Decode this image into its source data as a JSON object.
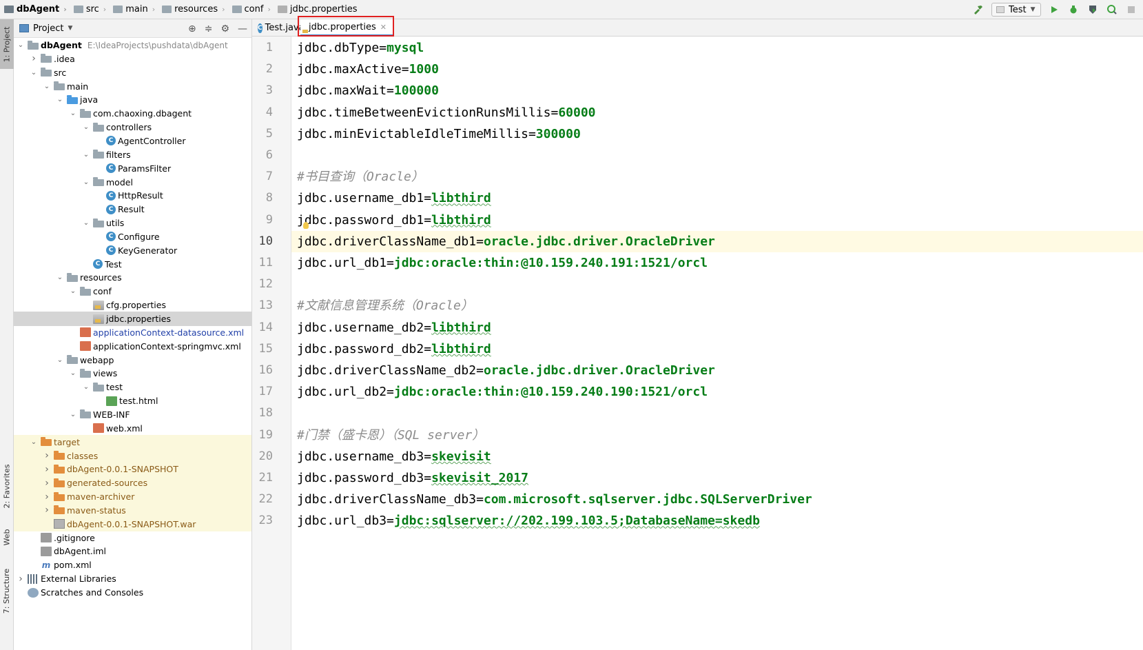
{
  "breadcrumb": [
    {
      "label": "dbAgent",
      "icon": "module-icon"
    },
    {
      "label": "src",
      "icon": "folder-icon"
    },
    {
      "label": "main",
      "icon": "folder-icon"
    },
    {
      "label": "resources",
      "icon": "resources-folder-icon"
    },
    {
      "label": "conf",
      "icon": "folder-icon"
    },
    {
      "label": "jdbc.properties",
      "icon": "properties-file-icon"
    }
  ],
  "toolbar": {
    "run_config": "Test"
  },
  "left_strip": {
    "project_tab": "1: Project",
    "favorites_tab": "2: Favorites",
    "web_tab": "Web",
    "structure_tab": "7: Structure"
  },
  "project_panel": {
    "title": "Project"
  },
  "tree": [
    {
      "label": "dbAgent",
      "path": "E:\\IdeaProjects\\pushdata\\dbAgent",
      "depth": 0,
      "arrow": "down",
      "icon": "module",
      "style": "bold"
    },
    {
      "label": ".idea",
      "depth": 1,
      "arrow": "right",
      "icon": "folder"
    },
    {
      "label": "src",
      "depth": 1,
      "arrow": "down",
      "icon": "folder"
    },
    {
      "label": "main",
      "depth": 2,
      "arrow": "down",
      "icon": "folder"
    },
    {
      "label": "java",
      "depth": 3,
      "arrow": "down",
      "icon": "folder-src"
    },
    {
      "label": "com.chaoxing.dbagent",
      "depth": 4,
      "arrow": "down",
      "icon": "package"
    },
    {
      "label": "controllers",
      "depth": 5,
      "arrow": "down",
      "icon": "package"
    },
    {
      "label": "AgentController",
      "depth": 6,
      "arrow": "",
      "icon": "class"
    },
    {
      "label": "filters",
      "depth": 5,
      "arrow": "down",
      "icon": "package"
    },
    {
      "label": "ParamsFilter",
      "depth": 6,
      "arrow": "",
      "icon": "class"
    },
    {
      "label": "model",
      "depth": 5,
      "arrow": "down",
      "icon": "package"
    },
    {
      "label": "HttpResult",
      "depth": 6,
      "arrow": "",
      "icon": "class"
    },
    {
      "label": "Result",
      "depth": 6,
      "arrow": "",
      "icon": "class"
    },
    {
      "label": "utils",
      "depth": 5,
      "arrow": "down",
      "icon": "package"
    },
    {
      "label": "Configure",
      "depth": 6,
      "arrow": "",
      "icon": "class"
    },
    {
      "label": "KeyGenerator",
      "depth": 6,
      "arrow": "",
      "icon": "class"
    },
    {
      "label": "Test",
      "depth": 5,
      "arrow": "",
      "icon": "class"
    },
    {
      "label": "resources",
      "depth": 3,
      "arrow": "down",
      "icon": "folder-res"
    },
    {
      "label": "conf",
      "depth": 4,
      "arrow": "down",
      "icon": "folder"
    },
    {
      "label": "cfg.properties",
      "depth": 5,
      "arrow": "",
      "icon": "properties"
    },
    {
      "label": "jdbc.properties",
      "depth": 5,
      "arrow": "",
      "icon": "properties",
      "selected": true
    },
    {
      "label": "applicationContext-datasource.xml",
      "depth": 4,
      "arrow": "",
      "icon": "xml",
      "style": "blue"
    },
    {
      "label": "applicationContext-springmvc.xml",
      "depth": 4,
      "arrow": "",
      "icon": "xml"
    },
    {
      "label": "webapp",
      "depth": 3,
      "arrow": "down",
      "icon": "folder-web"
    },
    {
      "label": "views",
      "depth": 4,
      "arrow": "down",
      "icon": "folder"
    },
    {
      "label": "test",
      "depth": 5,
      "arrow": "down",
      "icon": "folder"
    },
    {
      "label": "test.html",
      "depth": 6,
      "arrow": "",
      "icon": "html"
    },
    {
      "label": "WEB-INF",
      "depth": 4,
      "arrow": "down",
      "icon": "folder"
    },
    {
      "label": "web.xml",
      "depth": 5,
      "arrow": "",
      "icon": "xml"
    },
    {
      "label": "target",
      "depth": 1,
      "arrow": "down",
      "icon": "folder-orange",
      "style": "brown",
      "excluded": true
    },
    {
      "label": "classes",
      "depth": 2,
      "arrow": "right",
      "icon": "folder-orange",
      "style": "brown",
      "excluded": true
    },
    {
      "label": "dbAgent-0.0.1-SNAPSHOT",
      "depth": 2,
      "arrow": "right",
      "icon": "folder-orange",
      "style": "brown",
      "excluded": true
    },
    {
      "label": "generated-sources",
      "depth": 2,
      "arrow": "right",
      "icon": "folder-orange",
      "style": "brown",
      "excluded": true
    },
    {
      "label": "maven-archiver",
      "depth": 2,
      "arrow": "right",
      "icon": "folder-orange",
      "style": "brown",
      "excluded": true
    },
    {
      "label": "maven-status",
      "depth": 2,
      "arrow": "right",
      "icon": "folder-orange",
      "style": "brown",
      "excluded": true
    },
    {
      "label": "dbAgent-0.0.1-SNAPSHOT.war",
      "depth": 2,
      "arrow": "",
      "icon": "war",
      "style": "brown",
      "excluded": true
    },
    {
      "label": ".gitignore",
      "depth": 1,
      "arrow": "",
      "icon": "git"
    },
    {
      "label": "dbAgent.iml",
      "depth": 1,
      "arrow": "",
      "icon": "iml"
    },
    {
      "label": "pom.xml",
      "depth": 1,
      "arrow": "",
      "icon": "maven"
    },
    {
      "label": "External Libraries",
      "depth": 0,
      "arrow": "right",
      "icon": "libs"
    },
    {
      "label": "Scratches and Consoles",
      "depth": 0,
      "arrow": "",
      "icon": "scratch"
    }
  ],
  "tabs": [
    {
      "label": "Test.java",
      "icon": "class",
      "active": false
    },
    {
      "label": "jdbc.properties",
      "icon": "properties",
      "active": true
    }
  ],
  "editor": {
    "current_line": 10,
    "lines": [
      {
        "n": "1",
        "key": "jdbc.dbType",
        "value": "mysql"
      },
      {
        "n": "2",
        "key": "jdbc.maxActive",
        "value": "1000"
      },
      {
        "n": "3",
        "key": "jdbc.maxWait",
        "value": "100000"
      },
      {
        "n": "4",
        "key": "jdbc.timeBetweenEvictionRunsMillis",
        "value": "60000"
      },
      {
        "n": "5",
        "key": "jdbc.minEvictableIdleTimeMillis",
        "value": "300000"
      },
      {
        "n": "6"
      },
      {
        "n": "7",
        "comment": "#书目查询（Oracle）"
      },
      {
        "n": "8",
        "key": "jdbc.username_db1",
        "value": "libthird",
        "squiggle": true
      },
      {
        "n": "9",
        "key": "jdbc.password_db1",
        "value": "libthird",
        "squiggle": true,
        "bulb": true
      },
      {
        "n": "10",
        "key": "jdbc.driverClassName_db1",
        "value": "oracle.jdbc.driver.OracleDriver"
      },
      {
        "n": "11",
        "key": "jdbc.url_db1",
        "value": "jdbc:oracle:thin:@10.159.240.191:1521/orcl"
      },
      {
        "n": "12"
      },
      {
        "n": "13",
        "comment": "#文献信息管理系统（Oracle）"
      },
      {
        "n": "14",
        "key": "jdbc.username_db2",
        "value": "libthird",
        "squiggle": true
      },
      {
        "n": "15",
        "key": "jdbc.password_db2",
        "value": "libthird",
        "squiggle": true
      },
      {
        "n": "16",
        "key": "jdbc.driverClassName_db2",
        "value": "oracle.jdbc.driver.OracleDriver"
      },
      {
        "n": "17",
        "key": "jdbc.url_db2",
        "value": "jdbc:oracle:thin:@10.159.240.190:1521/orcl"
      },
      {
        "n": "18"
      },
      {
        "n": "19",
        "comment": "#门禁（盛卡恩）（SQL server）"
      },
      {
        "n": "20",
        "key": "jdbc.username_db3",
        "value": "skevisit",
        "squiggle": true
      },
      {
        "n": "21",
        "key": "jdbc.password_db3",
        "value": "skevisit_2017",
        "squiggle": true
      },
      {
        "n": "22",
        "key": "jdbc.driverClassName_db3",
        "value": "com.microsoft.sqlserver.jdbc.SQLServerDriver"
      },
      {
        "n": "23",
        "key": "jdbc.url_db3",
        "value": "jdbc:sqlserver://202.199.103.5;DatabaseName=skedb",
        "squiggle": true
      }
    ]
  },
  "colors": {
    "value_green": "#067d17",
    "comment_gray": "#8c8c8c",
    "highlight_red": "#e02020",
    "selection_gray": "#d5d5d5",
    "current_line": "#fffae3"
  }
}
